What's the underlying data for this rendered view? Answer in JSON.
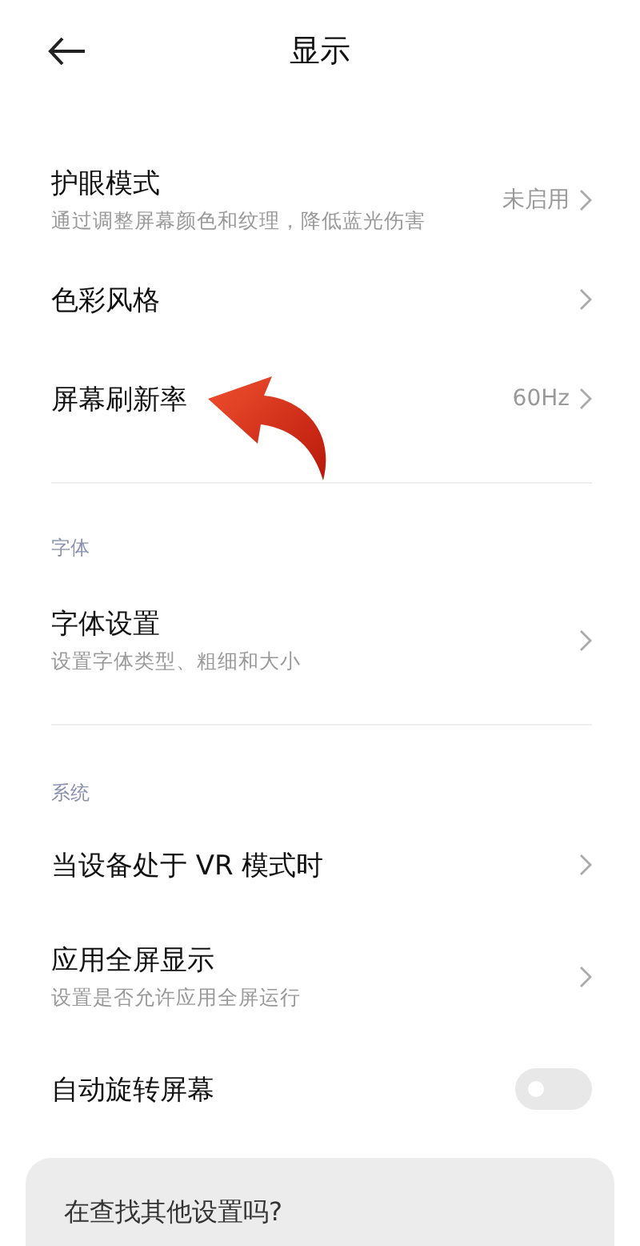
{
  "header": {
    "title": "显示"
  },
  "sections": [
    {
      "items": [
        {
          "kind": "link",
          "title": "护眼模式",
          "subtitle": "通过调整屏幕颜色和纹理，降低蓝光伤害",
          "value": "未启用"
        },
        {
          "kind": "link",
          "title": "色彩风格"
        },
        {
          "kind": "link",
          "title": "屏幕刷新率",
          "value": "60Hz"
        }
      ]
    },
    {
      "label": "字体",
      "items": [
        {
          "kind": "link",
          "title": "字体设置",
          "subtitle": "设置字体类型、粗细和大小"
        }
      ]
    },
    {
      "label": "系统",
      "items": [
        {
          "kind": "link",
          "title": "当设备处于 VR 模式时"
        },
        {
          "kind": "link",
          "title": "应用全屏显示",
          "subtitle": "设置是否允许应用全屏运行"
        },
        {
          "kind": "toggle",
          "title": "自动旋转屏幕",
          "on": false
        }
      ]
    }
  ],
  "footer_card": {
    "text": "在查找其他设置吗?"
  }
}
